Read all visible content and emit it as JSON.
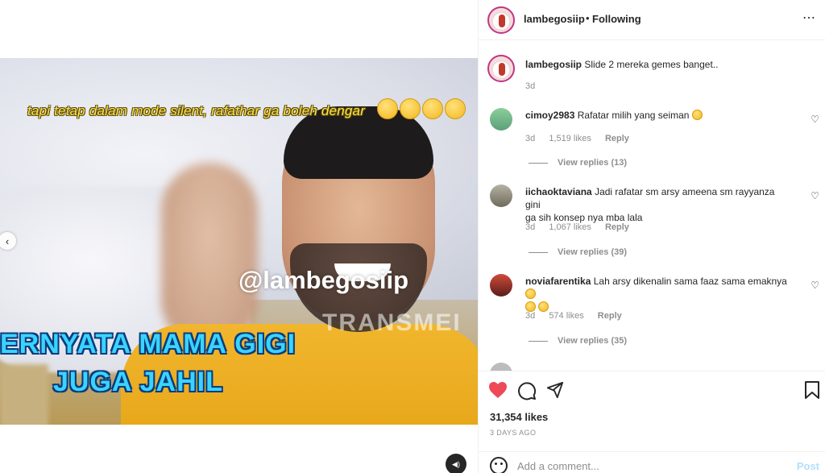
{
  "post": {
    "username": "lambegosiip",
    "separator": "•",
    "follow_status": "Following",
    "more_icon": "⋯",
    "caption": "Slide 2 mereka gemes banget..",
    "caption_age": "3d"
  },
  "media": {
    "top_caption": "tapi tetap dalam mode silent, rafathar ga boleh dengar",
    "watermark": "@lambegosiip",
    "station": "TRANSMEI",
    "big_text_line1": "ERNYATA MAMA GIGI",
    "big_text_line2": "JUGA JAHIL",
    "prev_icon": "‹",
    "audio_icon": "◀)"
  },
  "comments": [
    {
      "user": "cimoy2983",
      "text": "Rafatar milih yang seiman",
      "age": "3d",
      "likes": "1,519 likes",
      "reply": "Reply",
      "view_replies": "View replies (13)"
    },
    {
      "user": "iichaoktaviana",
      "text": "Jadi rafatar sm arsy ameena sm rayyanza gini",
      "text2": "ga sih konsep nya mba lala",
      "age": "3d",
      "likes": "1,067 likes",
      "reply": "Reply",
      "view_replies": "View replies (39)"
    },
    {
      "user": "noviafarentika",
      "text": "Lah arsy dikenalin sama faaz sama emaknya",
      "age": "3d",
      "likes": "574 likes",
      "reply": "Reply",
      "view_replies": "View replies (35)"
    }
  ],
  "actions": {
    "like_count": "31,354 likes",
    "date": "3 DAYS AGO",
    "like_icon": "heart-icon",
    "comment_icon": "comment-icon",
    "share_icon": "share-icon",
    "save_icon": "bookmark-icon",
    "like_color": "#ed4956"
  },
  "add_comment": {
    "placeholder": "Add a comment...",
    "post_label": "Post"
  }
}
